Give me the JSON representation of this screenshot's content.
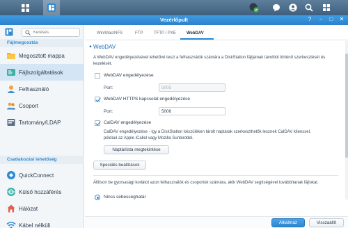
{
  "window": {
    "title": "Vezérlőpult"
  },
  "taskbar": {
    "left_icons": [
      "grid-icon",
      "control-panel-icon"
    ],
    "right_icons": [
      "sync-check-icon",
      "chat-icon",
      "user-icon",
      "search-icon",
      "widgets-icon"
    ]
  },
  "sidebar": {
    "search_placeholder": "Keresés",
    "sections": [
      {
        "title": "Fájlmegosztás"
      },
      {
        "title": "Csatlakozási lehetőség"
      }
    ],
    "items": [
      {
        "label": "Megosztott mappa",
        "icon": "folder-icon"
      },
      {
        "label": "Fájlszolgáltatások",
        "icon": "file-services-icon"
      },
      {
        "label": "Felhasználó",
        "icon": "user-icon"
      },
      {
        "label": "Csoport",
        "icon": "group-icon"
      },
      {
        "label": "Tartomány/LDAP",
        "icon": "domain-ldap-icon"
      },
      {
        "label": "QuickConnect",
        "icon": "quickconnect-icon"
      },
      {
        "label": "Külső hozzáférés",
        "icon": "external-access-icon"
      },
      {
        "label": "Hálózat",
        "icon": "network-icon"
      },
      {
        "label": "Kábel nélküli",
        "icon": "wireless-icon"
      }
    ],
    "selected_item": "Fájlszolgáltatások"
  },
  "tabs": [
    {
      "label": "Win/Mac/NFS"
    },
    {
      "label": "FTP"
    },
    {
      "label": "TFTP / PXE"
    },
    {
      "label": "WebDAV"
    }
  ],
  "active_tab": "WebDAV",
  "webdav": {
    "section_title": "WebDAV",
    "description": "A WebDAV engedélyezésével lehetővé teszi a felhasználók számára a DiskStation fájljainak távolból történő szerkesztését és kezelését.",
    "enable_webdav": {
      "label": "WebDAV engedélyezése",
      "checked": false
    },
    "port_label_1": "Port:",
    "port_value_1": "5005",
    "enable_https": {
      "label": "WebDAV HTTPS kapcsolat engedélyezése",
      "checked": true
    },
    "port_label_2": "Port:",
    "port_value_2": "5006",
    "enable_caldav": {
      "label": "CalDAV engedélyezése",
      "checked": true
    },
    "caldav_description": "CalDAV engedélyezése - így a DiskStation készüléken tárolt naptárak szerkeszthetők lesznek CalDAV klienssel, például az Apple iCallel vagy Mozilla Sunbirddel.",
    "calendar_list_button": "Naptárlista megtekintése",
    "advanced_button": "Speciális beállítások",
    "rate_limit_description": "Állítson be gyorsasági korlátot azon felhasználók és csoportok számára, akik WebDAV segítségével továbbítanak fájlokat.",
    "rate_limit_option": "Nincs sebességhatár"
  },
  "footer": {
    "apply_label": "Alkalmaz",
    "cancel_label": "Visszaállít"
  },
  "colors": {
    "accent": "#2d8ad3",
    "titlebar": "#2a82cc",
    "taskbar": "#4a6b89",
    "selected_item_bg": "#d4e6f5"
  }
}
